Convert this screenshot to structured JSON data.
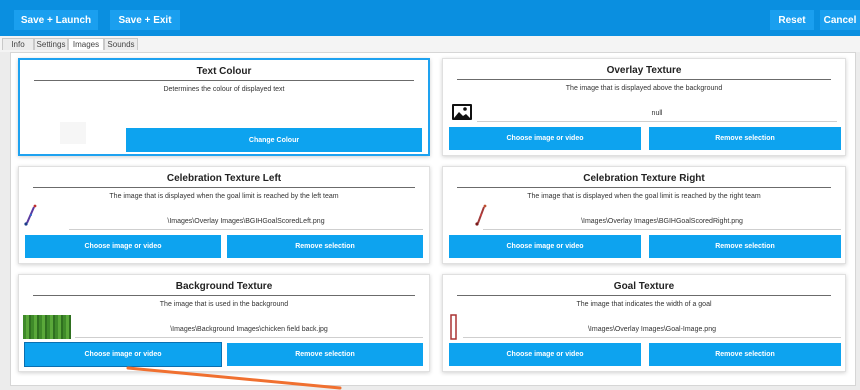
{
  "toolbar": {
    "save_launch": "Save + Launch",
    "save_exit": "Save + Exit",
    "reset": "Reset",
    "cancel": "Cancel"
  },
  "tabs": [
    "Info",
    "Settings",
    "Images",
    "Sounds"
  ],
  "active_tab": "Images",
  "cards": {
    "text_colour": {
      "title": "Text Colour",
      "description": "Determines the colour of displayed text",
      "button": "Change Colour"
    },
    "overlay_texture": {
      "title": "Overlay Texture",
      "description": "The image that is displayed above the background",
      "path": "null",
      "choose": "Choose image or video",
      "remove": "Remove selection"
    },
    "celebration_left": {
      "title": "Celebration Texture Left",
      "description": "The image that is displayed when the goal limit is reached by the left team",
      "path": "\\Images\\Overlay Images\\BGIHGoalScoredLeft.png",
      "choose": "Choose image or video",
      "remove": "Remove selection"
    },
    "celebration_right": {
      "title": "Celebration Texture Right",
      "description": "The image that is displayed when the goal limit is reached by the right team",
      "path": "\\Images\\Overlay Images\\BGIHGoalScoredRight.png",
      "choose": "Choose image or video",
      "remove": "Remove selection"
    },
    "background_texture": {
      "title": "Background Texture",
      "description": "The image that is used in the background",
      "path": "\\Images\\Background Images\\chicken field back.jpg",
      "choose": "Choose image or video",
      "remove": "Remove selection"
    },
    "goal_texture": {
      "title": "Goal Texture",
      "description": "The image that indicates the width of a goal",
      "path": "\\Images\\Overlay Images\\Goal-Image.png",
      "choose": "Choose image or video",
      "remove": "Remove selection"
    }
  },
  "icons": {
    "overlay_thumb": "image-placeholder-icon",
    "celebration_left_thumb": "celebration-left-thumbnail",
    "celebration_right_thumb": "celebration-right-thumbnail",
    "background_thumb": "grass-field-thumbnail",
    "goal_thumb": "goal-post-thumbnail",
    "annotation": "orange-arrow-annotation"
  },
  "colors": {
    "topbar": "#0a8fe0",
    "button": "#0da3ef",
    "selected_border": "#1ea2f0",
    "annotation": "#f07030"
  }
}
